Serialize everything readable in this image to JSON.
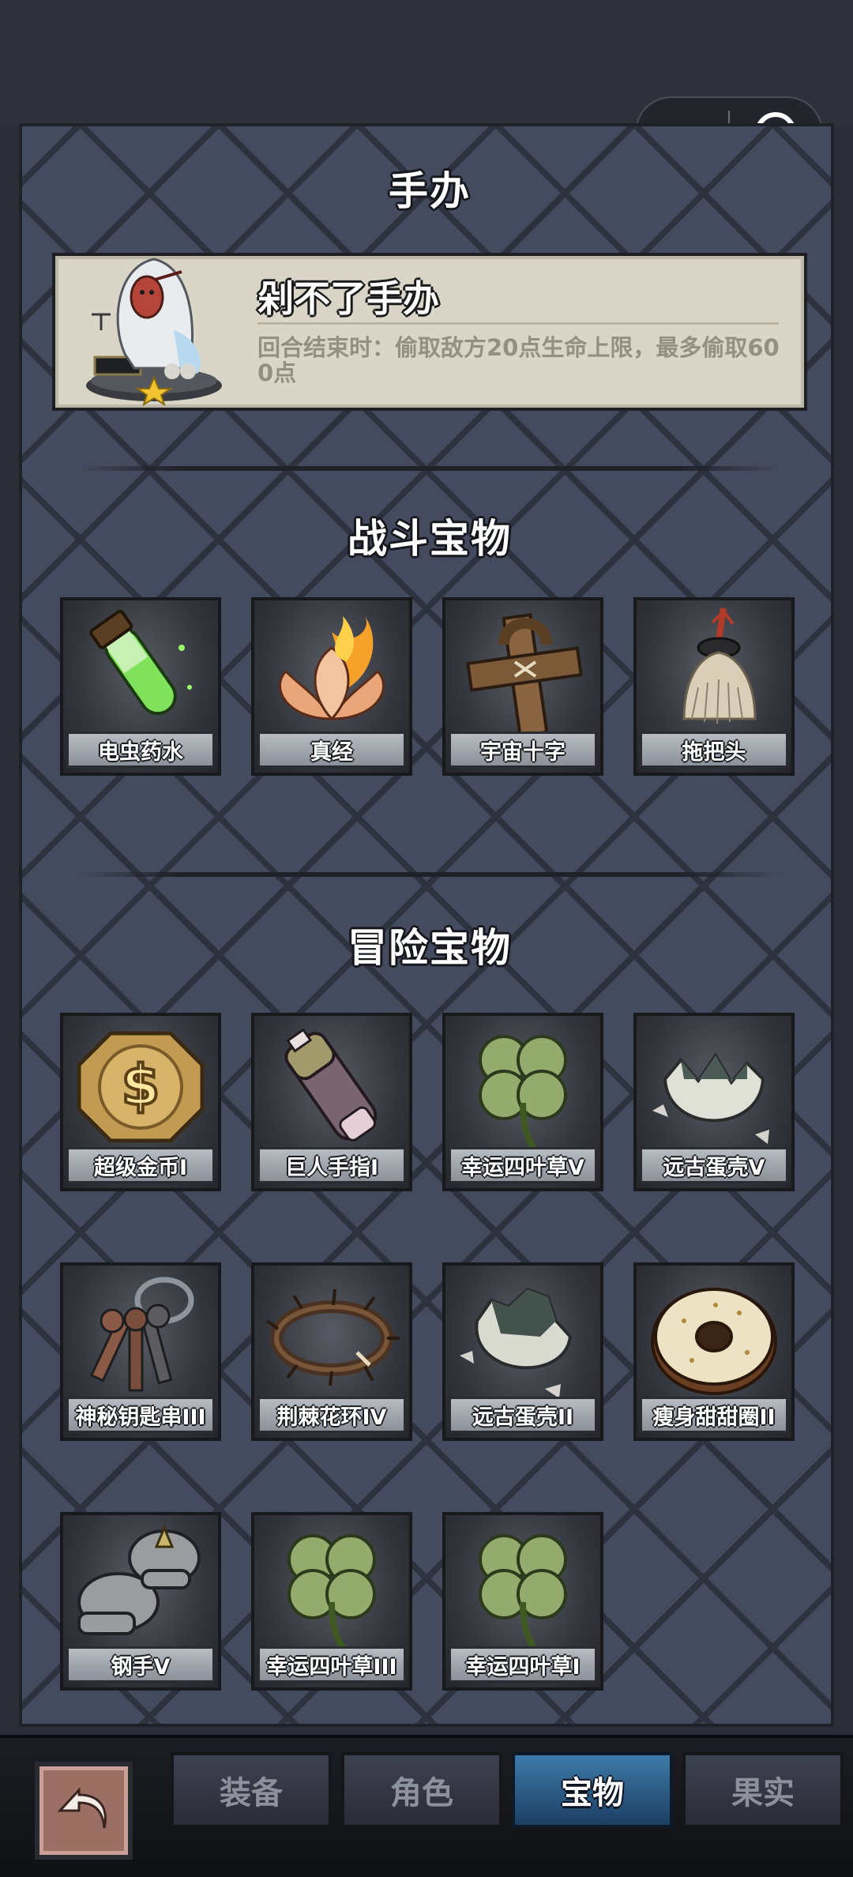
{
  "section_titles": {
    "figure": "手办",
    "combat": "战斗宝物",
    "adventure": "冒险宝物"
  },
  "figure": {
    "name": "剁不了手办",
    "description": "回合结束时：偷取敌方20点生命上限，最多偷取600点",
    "stars": 1
  },
  "combat_treasures": [
    {
      "label": "电虫药水",
      "icon": "potion-icon"
    },
    {
      "label": "真经",
      "icon": "flaming-lotus-icon"
    },
    {
      "label": "宇宙十字",
      "icon": "wooden-cross-icon"
    },
    {
      "label": "拖把头",
      "icon": "mop-head-icon"
    }
  ],
  "adventure_treasures": [
    {
      "label": "超级金币I",
      "icon": "gold-coin-icon"
    },
    {
      "label": "巨人手指I",
      "icon": "giant-finger-icon"
    },
    {
      "label": "幸运四叶草V",
      "icon": "clover-icon"
    },
    {
      "label": "远古蛋壳V",
      "icon": "eggshell-icon"
    },
    {
      "label": "神秘钥匙串III",
      "icon": "keyring-icon"
    },
    {
      "label": "荆棘花环IV",
      "icon": "thorn-wreath-icon"
    },
    {
      "label": "远古蛋壳II",
      "icon": "eggshell-icon"
    },
    {
      "label": "瘦身甜甜圈II",
      "icon": "donut-icon"
    },
    {
      "label": "钢手V",
      "icon": "steel-gauntlet-icon"
    },
    {
      "label": "幸运四叶草III",
      "icon": "clover-icon"
    },
    {
      "label": "幸运四叶草I",
      "icon": "clover-icon"
    }
  ],
  "tabs": [
    {
      "label": "装备",
      "active": false
    },
    {
      "label": "角色",
      "active": false
    },
    {
      "label": "宝物",
      "active": true
    },
    {
      "label": "果实",
      "active": false
    }
  ],
  "colors": {
    "panel": "#454b5e",
    "active_tab": "#2f6a98",
    "figure_card": "#d9d6c8"
  }
}
